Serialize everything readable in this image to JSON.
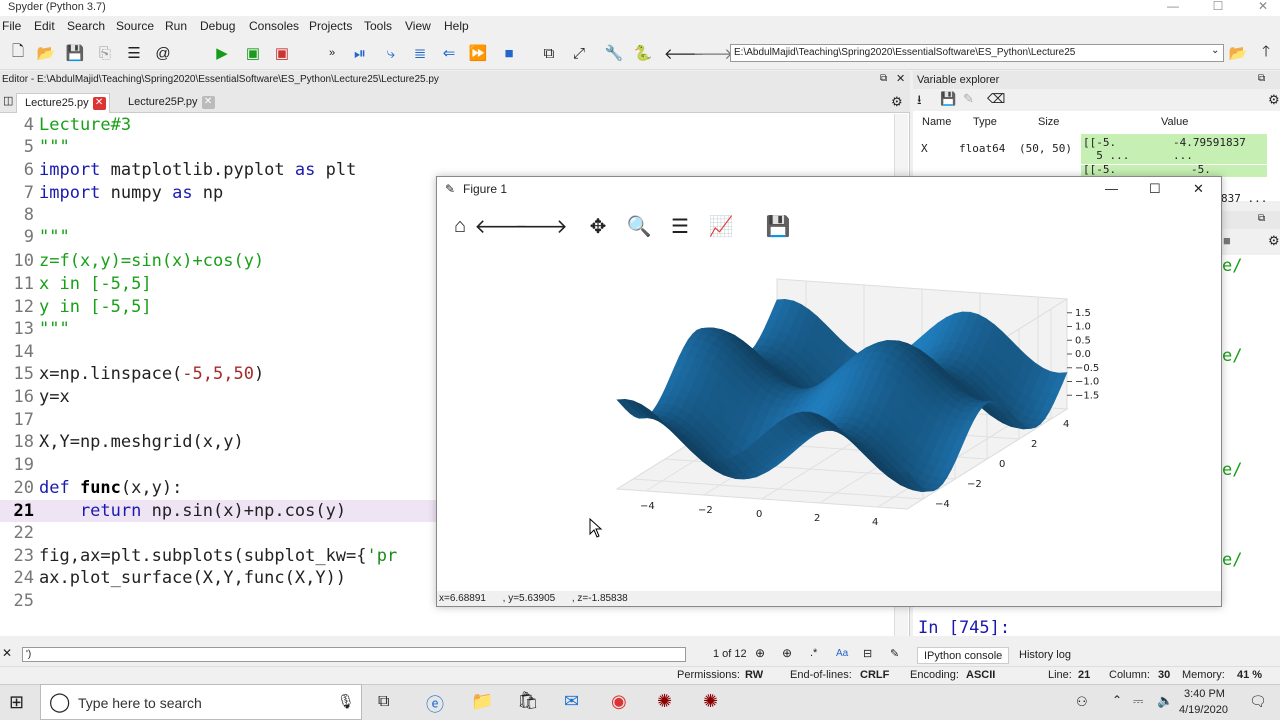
{
  "window": {
    "title": "Spyder (Python 3.7)",
    "minimize": "—",
    "maximize": "☐",
    "close": "✕"
  },
  "menu": [
    "File",
    "Edit",
    "Search",
    "Source",
    "Run",
    "Debug",
    "Consoles",
    "Projects",
    "Tools",
    "View",
    "Help"
  ],
  "toolbar": {
    "path": "E:\\AbdulMajid\\Teaching\\Spring2020\\EssentialSoftware\\ES_Python\\Lecture25"
  },
  "editor": {
    "header": "Editor - E:\\AbdulMajid\\Teaching\\Spring2020\\EssentialSoftware\\ES_Python\\Lecture25\\Lecture25.py",
    "tabs": [
      {
        "label": "Lecture25.py"
      },
      {
        "label": "Lecture25P.py"
      }
    ],
    "lines": [
      {
        "n": "4",
        "text": "Lecture#3"
      },
      {
        "n": "5",
        "text": "\"\"\""
      },
      {
        "n": "6",
        "a": "import",
        "b": " matplotlib.pyplot ",
        "c": "as",
        "d": " plt"
      },
      {
        "n": "7",
        "a": "import",
        "b": " numpy ",
        "c": "as",
        "d": " np"
      },
      {
        "n": "8",
        "text": ""
      },
      {
        "n": "9",
        "text": "\"\"\""
      },
      {
        "n": "10",
        "text": "z=f(x,y)=sin(x)+cos(y)"
      },
      {
        "n": "11",
        "text": "x in [-5,5]"
      },
      {
        "n": "12",
        "text": "y in [-5,5]"
      },
      {
        "n": "13",
        "text": "\"\"\""
      },
      {
        "n": "14",
        "text": ""
      },
      {
        "n": "15",
        "a": "x=np.linspace(",
        "b": "-5,5,50",
        "c": ")"
      },
      {
        "n": "16",
        "text": "y=x"
      },
      {
        "n": "17",
        "text": ""
      },
      {
        "n": "18",
        "text": "X,Y=np.meshgrid(x,y)"
      },
      {
        "n": "19",
        "text": ""
      },
      {
        "n": "20",
        "a": "def",
        "b": " func",
        "c": "(x,y):"
      },
      {
        "n": "21",
        "a": "    return",
        "b": " np.sin(x)+np.cos(y)"
      },
      {
        "n": "22",
        "text": ""
      },
      {
        "n": "23",
        "a": "fig,ax=plt.subplots(subplot_kw={",
        "b": "'pr"
      },
      {
        "n": "24",
        "text": "ax.plot_surface(X,Y,func(X,Y))"
      },
      {
        "n": "25",
        "text": ""
      }
    ]
  },
  "variable_explorer": {
    "title": "Variable explorer",
    "columns": [
      "Name",
      "Type",
      "Size",
      "Value"
    ],
    "rows": [
      {
        "name": "X",
        "type": "float64",
        "size": "(50, 50)",
        "value_a": "[[-5.\n  5 ...",
        "value_b": "-4.79591837 ..."
      },
      {
        "name": "",
        "type": "",
        "size": "",
        "value_a": "[[-5.",
        "value_b": "-5."
      }
    ],
    "partial": "837 ..."
  },
  "console": {
    "fragments": [
      "e/",
      "e/",
      "e/",
      "e/"
    ],
    "prompt": "In [745]:",
    "tabs": [
      "IPython console",
      "History log"
    ]
  },
  "find": {
    "query": "')",
    "count": "1 of 12"
  },
  "status": {
    "permissions_label": "Permissions:",
    "permissions": "RW",
    "eol_label": "End-of-lines:",
    "eol": "CRLF",
    "encoding_label": "Encoding:",
    "encoding": "ASCII",
    "line_label": "Line:",
    "line": "21",
    "column_label": "Column:",
    "column": "30",
    "memory_label": "Memory:",
    "memory": "41 %"
  },
  "figure": {
    "title": "Figure 1",
    "coords": "x=6.68891      , y=5.63905      , z=-1.85838",
    "surface_color": "#1f77b4",
    "z_ticks": [
      "1.5",
      "1.0",
      "0.5",
      "0.0",
      "−0.5",
      "−1.0",
      "−1.5"
    ],
    "x_ticks": [
      "−4",
      "−2",
      "0",
      "2",
      "4"
    ],
    "y_ticks": [
      "−4",
      "−2",
      "0",
      "2",
      "4"
    ]
  },
  "taskbar": {
    "search_placeholder": "Type here to search",
    "time": "3:40 PM",
    "date": "4/19/2020"
  }
}
